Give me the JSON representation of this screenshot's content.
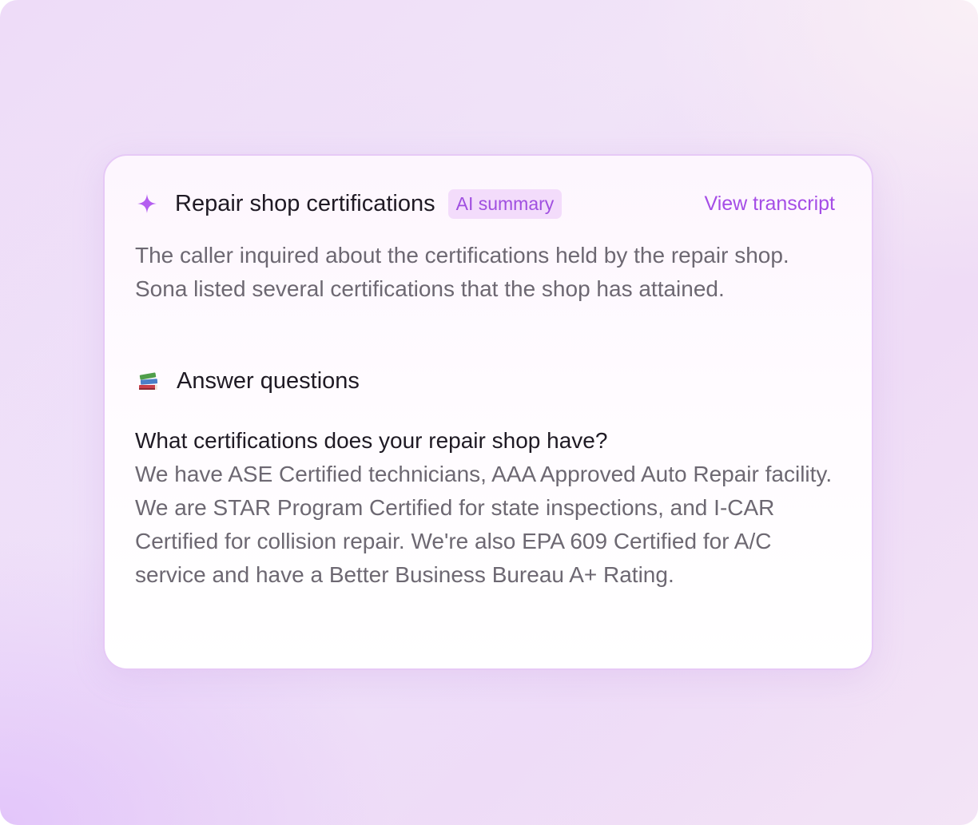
{
  "card": {
    "title": "Repair shop certifications",
    "badge": "AI summary",
    "view_transcript_label": "View transcript",
    "summary": "The caller inquired about the certifications held by the repair shop. Sona listed several certifications that the shop has attained.",
    "section": {
      "icon": "books-icon",
      "title": "Answer questions"
    },
    "qa": {
      "question": "What certifications does your repair shop have?",
      "answer": "We have ASE Certified technicians, AAA Approved Auto Repair facility. We are STAR Program Certified for state inspections, and I-CAR Certified for collision repair. We're also EPA 609 Certified for A/C service and have a Better Business Bureau A+ Rating."
    }
  },
  "colors": {
    "accent": "#a54de6",
    "badge_bg": "#f3dcfb",
    "sparkle": "#b45ef0"
  }
}
